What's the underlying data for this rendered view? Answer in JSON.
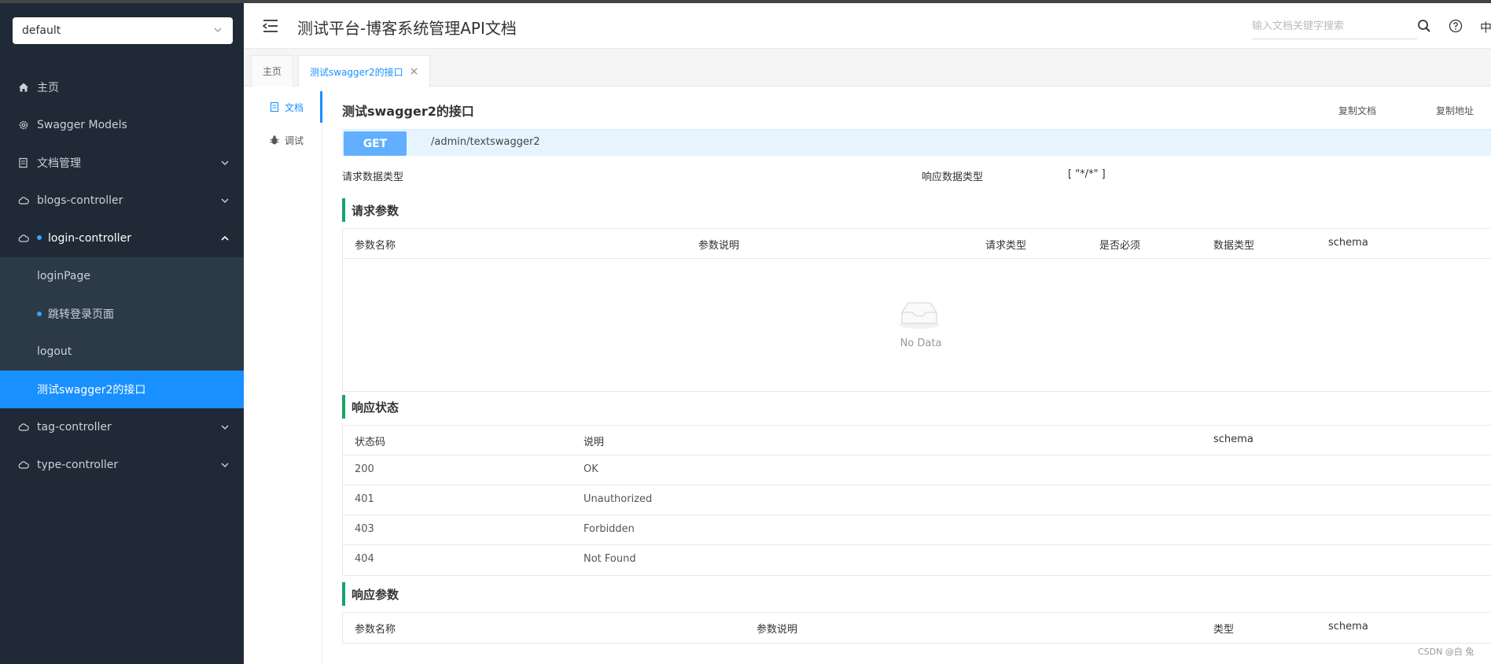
{
  "group_select": {
    "value": "default"
  },
  "sidebar": {
    "items": [
      {
        "label": "主页"
      },
      {
        "label": "Swagger Models"
      },
      {
        "label": "文档管理"
      },
      {
        "label": "blogs-controller"
      },
      {
        "label": "login-controller"
      },
      {
        "label": "tag-controller"
      },
      {
        "label": "type-controller"
      }
    ],
    "sub_items": [
      {
        "label": "loginPage"
      },
      {
        "label": "跳转登录页面"
      },
      {
        "label": "logout"
      },
      {
        "label": "测试swagger2的接口"
      }
    ]
  },
  "header": {
    "title": "测试平台-博客系统管理API文档",
    "search_placeholder": "输入文档关键字搜索",
    "lang": "中"
  },
  "tabs": [
    {
      "label": "主页"
    },
    {
      "label": "测试swagger2的接口",
      "close": "×"
    }
  ],
  "doc_menu": [
    {
      "label": "文档"
    },
    {
      "label": "调试"
    }
  ],
  "api": {
    "title": "测试swagger2的接口",
    "copy_doc": "复制文档",
    "copy_url": "复制地址",
    "method": "GET",
    "path": "/admin/textswagger2",
    "req_type_label": "请求数据类型",
    "resp_type_label": "响应数据类型",
    "resp_type_value": "[ \"*/*\" ]"
  },
  "request_params": {
    "title": "请求参数",
    "headers": [
      "参数名称",
      "参数说明",
      "请求类型",
      "是否必须",
      "数据类型",
      "schema"
    ],
    "empty_text": "No Data"
  },
  "response_status": {
    "title": "响应状态",
    "headers": [
      "状态码",
      "说明",
      "schema"
    ],
    "rows": [
      {
        "code": "200",
        "desc": "OK"
      },
      {
        "code": "401",
        "desc": "Unauthorized"
      },
      {
        "code": "403",
        "desc": "Forbidden"
      },
      {
        "code": "404",
        "desc": "Not Found"
      }
    ]
  },
  "response_params": {
    "title": "响应参数",
    "headers": [
      "参数名称",
      "参数说明",
      "类型",
      "schema"
    ]
  },
  "watermark": "CSDN @白 兔",
  "colors": {
    "sidebar_bg": "#1f2a36",
    "active": "#1890ff",
    "get_method": "#61affe",
    "section_accent": "#17a46b"
  }
}
